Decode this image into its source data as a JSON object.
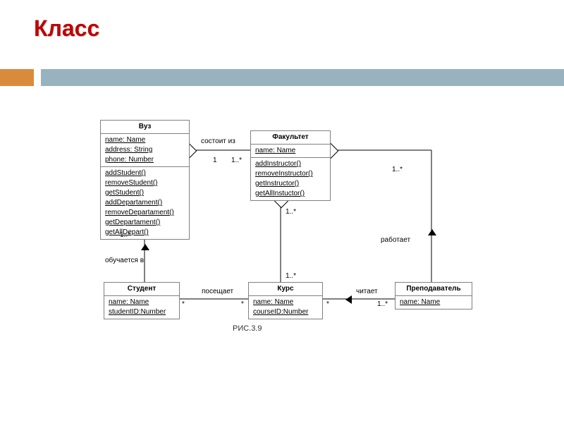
{
  "title": "Класс",
  "caption": "РИС.3.9",
  "classes": {
    "university": {
      "name": "Вуз",
      "attrs": [
        "name: Name",
        "address: String",
        "phone: Number"
      ],
      "ops": [
        "addStudent()",
        "removeStudent()",
        "getStudent()",
        "addDepartament()",
        "removeDepartament()",
        "getDepartament()",
        "getAllDepart()"
      ]
    },
    "faculty": {
      "name": "Факультет",
      "attrs": [
        "name: Name"
      ],
      "ops": [
        "addInstructor()",
        "removeInstructor()",
        "getInstructor()",
        "getAllInstuctor()"
      ]
    },
    "student": {
      "name": "Студент",
      "attrs": [
        "name: Name",
        "studentID:Number"
      ],
      "ops": []
    },
    "course": {
      "name": "Курс",
      "attrs": [
        "name: Name",
        "courseID:Number"
      ],
      "ops": []
    },
    "teacher": {
      "name": "Преподаватель",
      "attrs": [
        "name: Name"
      ],
      "ops": []
    }
  },
  "assoc": {
    "uni_fac_label": "состоит из",
    "stud_uni_label": "обучается в",
    "stud_course_label": "посещает",
    "course_teacher_label": "читает",
    "teacher_fac_label": "работает"
  },
  "mult": {
    "uni_fac_uni": "1",
    "uni_fac_fac": "1..*",
    "stud_uni_uni": "1..*",
    "fac_course_fac": "1..*",
    "fac_course_course": "1..*",
    "fac_teacher_teacher": "1..*",
    "stud_course_stud": "*",
    "stud_course_course": "*",
    "course_teacher_course": "*",
    "course_teacher_teacher": "1..*"
  }
}
